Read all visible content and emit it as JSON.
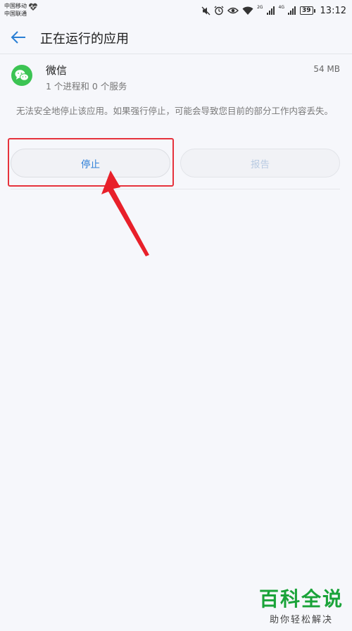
{
  "status_bar": {
    "carrier_1": "中国移动",
    "carrier_2": "中国联通",
    "signal_2g": "2G",
    "signal_4g": "4G",
    "battery": "39",
    "time": "13:12"
  },
  "app_bar": {
    "title": "正在运行的应用"
  },
  "app": {
    "name": "微信",
    "size": "54 MB",
    "processes": "1 个进程和 0 个服务",
    "icon": "wechat-icon",
    "icon_color": "#3cc453"
  },
  "warning": "无法安全地停止该应用。如果强行停止，可能会导致您目前的部分工作内容丢失。",
  "buttons": {
    "stop": "停止",
    "report": "报告"
  },
  "annotation": {
    "highlight_color": "#e6323c"
  },
  "watermark": {
    "title": "百科全说",
    "subtitle": "助你轻松解决"
  }
}
